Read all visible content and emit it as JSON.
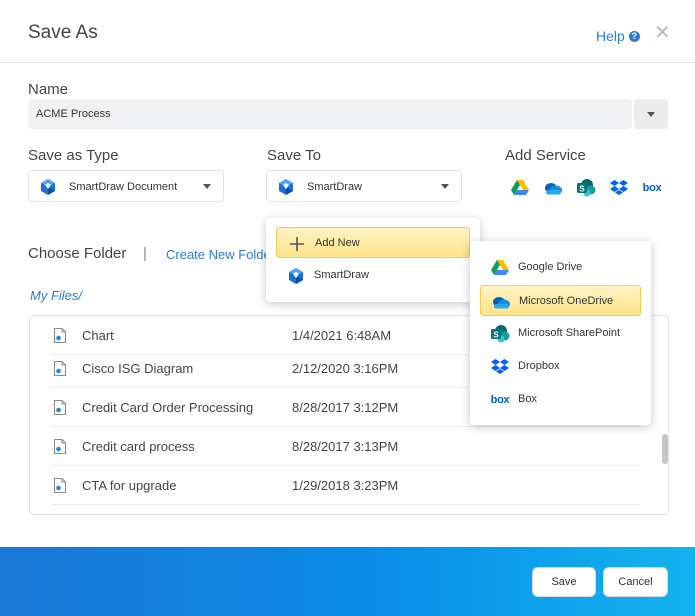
{
  "dialog": {
    "title": "Save As",
    "help_label": "Help",
    "help_icon": "question-circle-icon",
    "close_icon": "close-icon"
  },
  "name": {
    "label": "Name",
    "value": "ACME Process"
  },
  "save_as_type": {
    "label": "Save as Type",
    "selected": "SmartDraw Document"
  },
  "save_to": {
    "label": "Save To",
    "selected": "SmartDraw"
  },
  "add_service": {
    "label": "Add Service",
    "icons": [
      "google-drive-icon",
      "onedrive-icon",
      "sharepoint-icon",
      "dropbox-icon",
      "box-icon"
    ],
    "box_text": "box"
  },
  "folder": {
    "choose_label": "Choose Folder",
    "separator": "|",
    "create_label": "Create New Folder",
    "breadcrumb": "My Files/"
  },
  "files": [
    {
      "name": "Chart",
      "date": "1/4/2021 6:48AM"
    },
    {
      "name": "Cisco ISG Diagram",
      "date": "2/12/2020 3:16PM"
    },
    {
      "name": "Credit Card Order Processing",
      "date": "8/28/2017 3:12PM"
    },
    {
      "name": "Credit card process",
      "date": "8/28/2017 3:13PM"
    },
    {
      "name": "CTA for upgrade",
      "date": "1/29/2018 3:23PM"
    }
  ],
  "save_to_menu": {
    "items": [
      {
        "label": "Add New",
        "icon": "plus-icon",
        "highlighted": true
      },
      {
        "label": "SmartDraw",
        "icon": "smartdraw-logo-icon",
        "highlighted": false
      }
    ]
  },
  "services_menu": {
    "items": [
      {
        "label": "Google Drive",
        "icon": "google-drive-icon",
        "highlighted": false
      },
      {
        "label": "Microsoft OneDrive",
        "icon": "onedrive-icon",
        "highlighted": true
      },
      {
        "label": "Microsoft SharePoint",
        "icon": "sharepoint-icon",
        "highlighted": false
      },
      {
        "label": "Dropbox",
        "icon": "dropbox-icon",
        "highlighted": false
      },
      {
        "label": "Box",
        "icon": "box-icon",
        "highlighted": false
      }
    ],
    "box_text": "box"
  },
  "footer": {
    "save_label": "Save",
    "cancel_label": "Cancel"
  },
  "colors": {
    "accent": "#2a7bd4",
    "highlight": "#fde48a",
    "footer_start": "#1a78d6",
    "footer_end": "#13b3ef"
  }
}
